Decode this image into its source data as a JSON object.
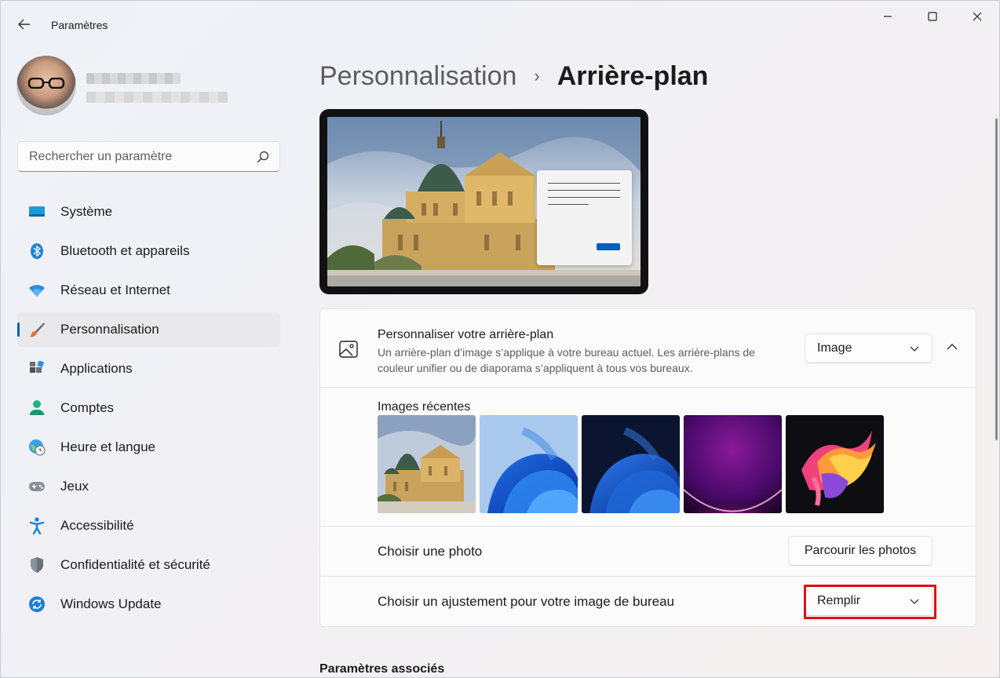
{
  "window": {
    "app_title": "Paramètres"
  },
  "search": {
    "placeholder": "Rechercher un paramètre"
  },
  "sidebar": {
    "items": [
      {
        "label": "Système",
        "icon": "monitor-icon"
      },
      {
        "label": "Bluetooth et appareils",
        "icon": "bluetooth-icon"
      },
      {
        "label": "Réseau et Internet",
        "icon": "wifi-icon"
      },
      {
        "label": "Personnalisation",
        "icon": "paintbrush-icon",
        "active": true
      },
      {
        "label": "Applications",
        "icon": "apps-icon"
      },
      {
        "label": "Comptes",
        "icon": "person-icon"
      },
      {
        "label": "Heure et langue",
        "icon": "globe-clock-icon"
      },
      {
        "label": "Jeux",
        "icon": "gamepad-icon"
      },
      {
        "label": "Accessibilité",
        "icon": "accessibility-icon"
      },
      {
        "label": "Confidentialité et sécurité",
        "icon": "shield-icon"
      },
      {
        "label": "Windows Update",
        "icon": "refresh-icon"
      }
    ]
  },
  "breadcrumb": {
    "parent": "Personnalisation",
    "separator": "›",
    "current": "Arrière-plan"
  },
  "background_card": {
    "title": "Personnaliser votre arrière-plan",
    "description": "Un arrière-plan d’image s’applique à votre bureau actuel. Les arrière-plans de couleur unifier ou de diaporama s’appliquent à tous vos bureaux.",
    "type_dropdown_value": "Image",
    "recent_title": "Images récentes",
    "choose_photo_label": "Choisir une photo",
    "browse_button": "Parcourir les photos",
    "fit_label": "Choisir un ajustement pour votre image de bureau",
    "fit_dropdown_value": "Remplir"
  },
  "related_title": "Paramètres associés",
  "colors": {
    "accent": "#005fb8",
    "highlight": "#e01010"
  }
}
